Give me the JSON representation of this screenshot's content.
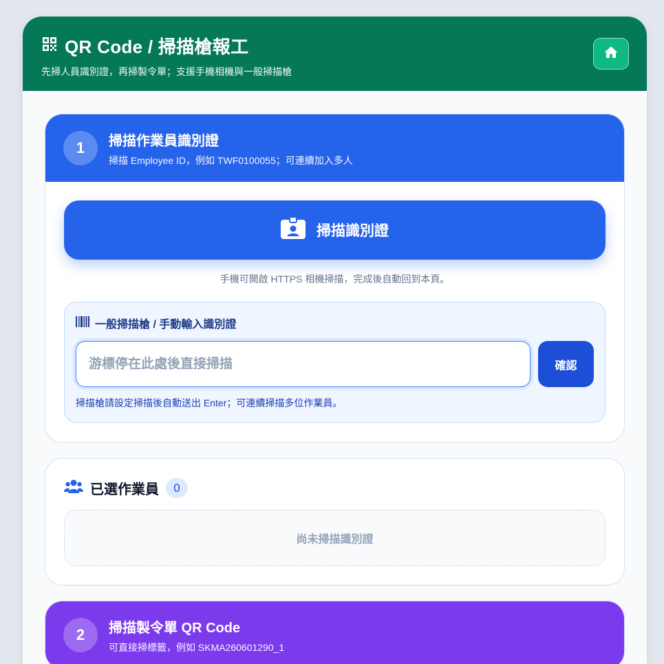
{
  "header": {
    "title": "QR Code / 掃描槍報工",
    "subtitle": "先掃人員識別證，再掃製令單；支援手機相機與一般掃描槍",
    "qr_icon": "qr-code-icon",
    "home_icon": "home-icon"
  },
  "step1": {
    "number": "1",
    "title": "掃描作業員識別證",
    "subtitle": "掃描 Employee ID，例如 TWF0100055；可連續加入多人",
    "scan_button_label": "掃描識別證",
    "scan_button_icon": "id-badge-icon",
    "hint": "手機可開啟 HTTPS 相機掃描，完成後自動回到本頁。",
    "manual": {
      "label": "一般掃描槍 / 手動輸入識別證",
      "label_icon": "barcode-icon",
      "input_value": "",
      "input_placeholder": "游標停在此處後直接掃描",
      "confirm_label": "確認",
      "note": "掃描槍請設定掃描後自動送出 Enter；可連續掃描多位作業員。"
    }
  },
  "selected": {
    "title": "已選作業員",
    "icon": "users-icon",
    "count": "0",
    "empty_text": "尚未掃描識別證"
  },
  "step2": {
    "number": "2",
    "title": "掃描製令單 QR Code",
    "subtitle": "可直接掃標籤，例如 SKMA260601290_1"
  },
  "colors": {
    "header_green": "#047857",
    "step1_blue": "#2563eb",
    "step2_purple": "#7c3aed"
  }
}
